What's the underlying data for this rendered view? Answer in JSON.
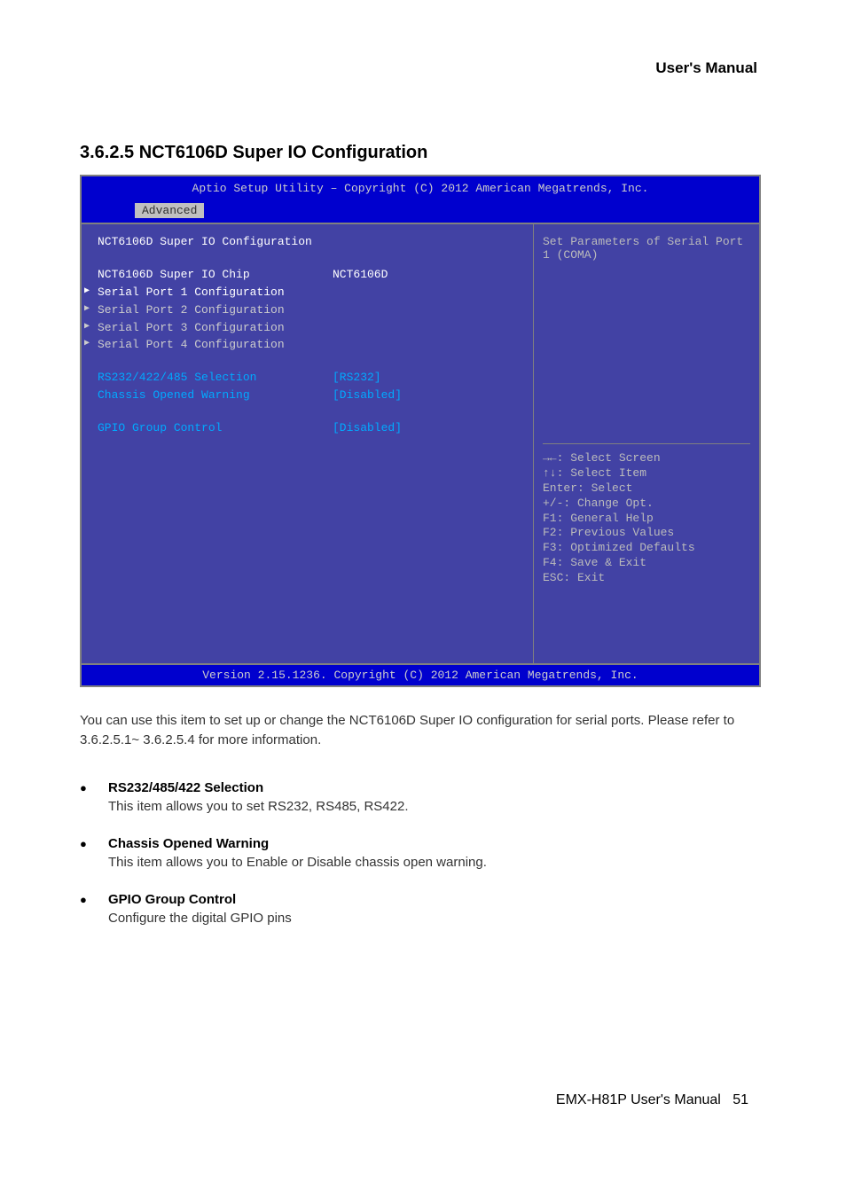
{
  "header": {
    "manual_title": "User's Manual"
  },
  "section": {
    "title": "3.6.2.5 NCT6106D Super IO Configuration"
  },
  "bios": {
    "title": "Aptio Setup Utility – Copyright (C) 2012 American Megatrends, Inc.",
    "tab": "Advanced",
    "heading": "NCT6106D Super IO Configuration",
    "chip_label": "NCT6106D Super IO Chip",
    "chip_value": "NCT6106D",
    "submenus": [
      "Serial Port 1 Configuration",
      "Serial Port 2 Configuration",
      "Serial Port 3 Configuration",
      "Serial Port 4 Configuration"
    ],
    "options": [
      {
        "label": "RS232/422/485 Selection",
        "value": "[RS232]"
      },
      {
        "label": "Chassis Opened Warning",
        "value": "[Disabled]"
      }
    ],
    "gpio": {
      "label": "GPIO Group Control",
      "value": "[Disabled]"
    },
    "help_text": "Set Parameters of Serial Port 1 (COMA)",
    "keys": [
      {
        "k": "→←",
        "d": ": Select Screen"
      },
      {
        "k": "↑↓",
        "d": ": Select Item"
      },
      {
        "k": "Enter",
        "d": ": Select"
      },
      {
        "k": "+/-",
        "d": ": Change Opt."
      },
      {
        "k": "F1",
        "d": ": General Help"
      },
      {
        "k": "F2",
        "d": ": Previous Values"
      },
      {
        "k": "F3",
        "d": ": Optimized Defaults"
      },
      {
        "k": "F4",
        "d": ": Save & Exit"
      },
      {
        "k": "ESC",
        "d": ": Exit"
      }
    ],
    "footer": "Version 2.15.1236. Copyright (C) 2012 American Megatrends, Inc."
  },
  "description": "You can use this item to set up or change the NCT6106D Super IO configuration for serial ports. Please refer to 3.6.2.5.1~ 3.6.2.5.4 for more information.",
  "bullets": [
    {
      "title": "RS232/485/422 Selection",
      "desc": "This item allows you to set RS232, RS485, RS422."
    },
    {
      "title": "Chassis Opened Warning",
      "desc": "This item allows you to Enable or Disable chassis open warning."
    },
    {
      "title": "GPIO Group Control",
      "desc": "Configure the digital GPIO pins"
    }
  ],
  "footer": {
    "prefix": "EMX-H81P User's Manual",
    "page": "51"
  }
}
